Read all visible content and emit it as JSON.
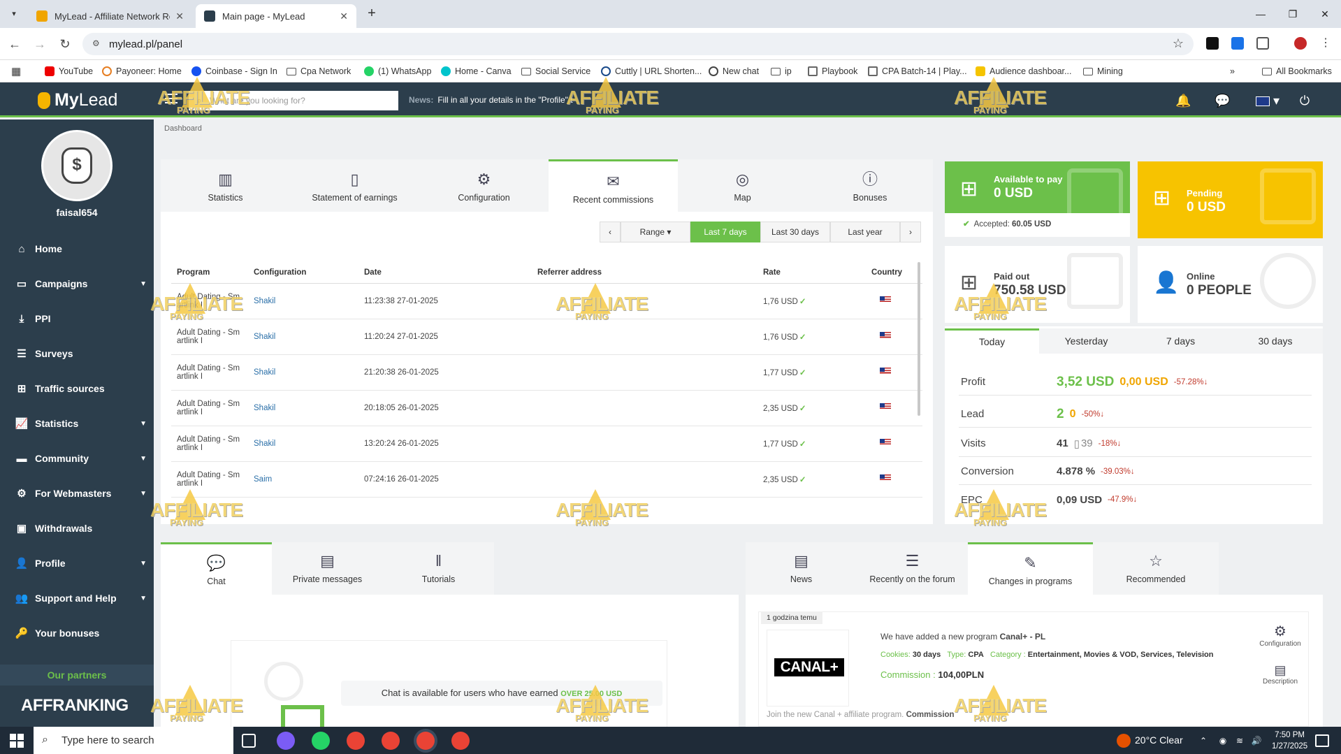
{
  "browser": {
    "tabs": [
      {
        "title": "MyLead - Affiliate Network Rev",
        "active": false
      },
      {
        "title": "Main page - MyLead",
        "active": true
      }
    ],
    "url": "mylead.pl/panel",
    "bookmarks": [
      "YouTube",
      "Payoneer: Home",
      "Coinbase - Sign In",
      "Cpa Network",
      "(1) WhatsApp",
      "Home - Canva",
      "Social Service",
      "Cuttly | URL Shorten...",
      "New chat",
      "ip",
      "Playbook",
      "CPA Batch-14 | Play...",
      "Audience dashboar...",
      "Mining"
    ],
    "all_bookmarks": "All Bookmarks"
  },
  "header": {
    "logo_my": "My",
    "logo_lead": "Lead",
    "search_placeholder": "What are you looking for?",
    "news_label": "News:",
    "news_text": "Fill in all your details in the \"Profile\" t"
  },
  "sidebar": {
    "username": "faisal654",
    "items": [
      {
        "label": "Home",
        "icon": "home-icon",
        "chevron": false
      },
      {
        "label": "Campaigns",
        "icon": "monitor-icon",
        "chevron": true
      },
      {
        "label": "PPI",
        "icon": "download-icon",
        "chevron": false
      },
      {
        "label": "Surveys",
        "icon": "list-icon",
        "chevron": false
      },
      {
        "label": "Traffic sources",
        "icon": "sitemap-icon",
        "chevron": false
      },
      {
        "label": "Statistics",
        "icon": "chart-icon",
        "chevron": true
      },
      {
        "label": "Community",
        "icon": "laptop-icon",
        "chevron": true
      },
      {
        "label": "For Webmasters",
        "icon": "cogs-icon",
        "chevron": true
      },
      {
        "label": "Withdrawals",
        "icon": "money-icon",
        "chevron": false
      },
      {
        "label": "Profile",
        "icon": "user-icon",
        "chevron": true
      },
      {
        "label": "Support and Help",
        "icon": "users-icon",
        "chevron": true
      },
      {
        "label": "Your bonuses",
        "icon": "key-icon",
        "chevron": false
      }
    ],
    "partners_label": "Our partners",
    "partner_logo": "AFFRANKING"
  },
  "breadcrumb": "Dashboard",
  "main_tabs": [
    "Statistics",
    "Statement of earnings",
    "Configuration",
    "Recent commissions",
    "Map",
    "Bonuses"
  ],
  "filters": {
    "range": "Range",
    "last7": "Last 7 days",
    "last30": "Last 30 days",
    "lastyear": "Last year"
  },
  "table": {
    "headers": [
      "Program",
      "Configuration",
      "Date",
      "Referrer address",
      "Rate",
      "Country"
    ],
    "rows": [
      {
        "program": "Adult Dating - Sm artlink I",
        "config": "Shakil",
        "date": "11:23:38 27-01-2025",
        "ref": "",
        "rate": "1,76 USD"
      },
      {
        "program": "Adult Dating - Sm artlink I",
        "config": "Shakil",
        "date": "11:20:24 27-01-2025",
        "ref": "",
        "rate": "1,76 USD"
      },
      {
        "program": "Adult Dating - Sm artlink I",
        "config": "Shakil",
        "date": "21:20:38 26-01-2025",
        "ref": "",
        "rate": "1,77 USD"
      },
      {
        "program": "Adult Dating - Sm artlink I",
        "config": "Shakil",
        "date": "20:18:05 26-01-2025",
        "ref": "",
        "rate": "2,35 USD"
      },
      {
        "program": "Adult Dating - Sm artlink I",
        "config": "Shakil",
        "date": "13:20:24 26-01-2025",
        "ref": "",
        "rate": "1,77 USD"
      },
      {
        "program": "Adult Dating - Sm artlink I",
        "config": "Saim",
        "date": "07:24:16 26-01-2025",
        "ref": "",
        "rate": "2,35 USD"
      }
    ]
  },
  "cards": {
    "available_label": "Available to pay",
    "available_value": "0 USD",
    "accepted_label": "Accepted:",
    "accepted_value": "60.05 USD",
    "pending_label": "Pending",
    "pending_value": "0 USD",
    "paid_label": "Paid out",
    "paid_value": "750.58 USD",
    "online_label": "Online",
    "online_value": "0 PEOPLE"
  },
  "stats": {
    "tabs": [
      "Today",
      "Yesterday",
      "7 days",
      "30 days"
    ],
    "profit": {
      "label": "Profit",
      "v1": "3,52 USD",
      "v2": "0,00 USD",
      "pct": "-57.28%"
    },
    "lead": {
      "label": "Lead",
      "v1": "2",
      "v2": "0",
      "pct": "-50%"
    },
    "visits": {
      "label": "Visits",
      "v1": "41",
      "v2": "39",
      "pct": "-18%"
    },
    "conversion": {
      "label": "Conversion",
      "v1": "4.878 %",
      "pct": "-39.03%"
    },
    "epc": {
      "label": "EPC",
      "v1": "0,09 USD",
      "pct": "-47.9%"
    }
  },
  "bottom_left_tabs": [
    "Chat",
    "Private messages",
    "Tutorials"
  ],
  "chat_notice": {
    "text": "Chat is available for users who have earned",
    "amount": "OVER 25.00 USD"
  },
  "bottom_right_tabs": [
    "News",
    "Recently on the forum",
    "Changes in programs",
    "Recommended"
  ],
  "program_card": {
    "time_badge": "1 godzina temu",
    "logo": "CANAL+",
    "headline_prefix": "We have added a new program",
    "headline_name": "Canal+ - PL",
    "cookies_label": "Cookies:",
    "cookies_value": "30 days",
    "type_label": "Type:",
    "type_value": "CPA",
    "category_label": "Category :",
    "category_value": "Entertainment, Movies & VOD, Services, Television",
    "commission_label": "Commission :",
    "commission_value": "104,00PLN",
    "config_label": "Configuration",
    "desc_label": "Description",
    "footer": "Join the new Canal + affiliate program.",
    "footer_bold": "Commission"
  },
  "watermark": {
    "line1": "AFFILIATE",
    "line2": "PAYING"
  },
  "taskbar": {
    "search_placeholder": "Type here to search",
    "weather": "20°C  Clear",
    "time": "7:50 PM",
    "date": "1/27/2025"
  },
  "colors": {
    "accent": "#6cc04a",
    "pending": "#f7c300",
    "sidebar": "#2c3e4c",
    "negative": "#c0392b"
  }
}
